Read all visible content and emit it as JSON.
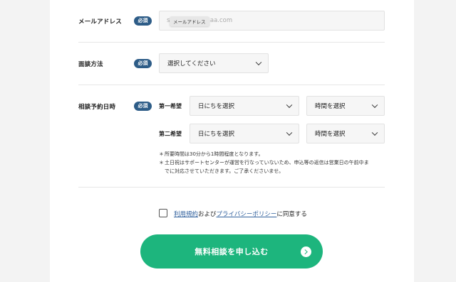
{
  "form": {
    "required_badge": "必須",
    "email": {
      "label": "メールアドレス",
      "placeholder": "aaaa.com",
      "placeholder_prefix": "s",
      "tooltip": "メールアドレス"
    },
    "method": {
      "label": "面談方法",
      "value": "選択してください"
    },
    "datetime": {
      "label": "相談予約日時",
      "first": {
        "label": "第一希望",
        "date": "日にちを選択",
        "time": "時間を選択"
      },
      "second": {
        "label": "第二希望",
        "date": "日にちを選択",
        "time": "時間を選択"
      },
      "notes": [
        "所要時間は30分から1時間程度となります。",
        "土日祝はサポートセンターが運営を行なっていないため、申込等の返信は営業日の午前中ま",
        "でに対応させていただきます。ご了承くださいませ。"
      ],
      "note_bullet": "＊"
    },
    "agreement": {
      "terms_link": "利用規約",
      "and": "および",
      "privacy_link": "プライバシーポリシー",
      "suffix": "に同意する",
      "checked": false
    },
    "submit_label": "無料相談を申し込む"
  }
}
